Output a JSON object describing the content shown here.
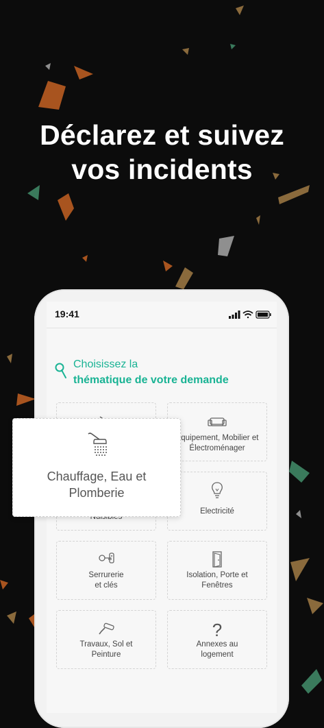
{
  "headline": {
    "line1": "Déclarez et suivez",
    "line2": "vos incidents"
  },
  "status_bar": {
    "time": "19:41"
  },
  "picker": {
    "title_line1": "Choisissez la",
    "title_line2": "thématique de votre demande",
    "accent_color": "#19b394"
  },
  "tiles": [
    {
      "label_line1": "Équipement, Mobilier et",
      "label_line2": "Électroménager",
      "icon": "sofa-icon"
    },
    {
      "label_line1": "Nuisibles",
      "label_line2": "",
      "icon": "bug-icon"
    },
    {
      "label_line1": "Electricité",
      "label_line2": "",
      "icon": "lightbulb-icon"
    },
    {
      "label_line1": "Serrurerie",
      "label_line2": "et clés",
      "icon": "keys-icon"
    },
    {
      "label_line1": "Isolation, Porte et",
      "label_line2": "Fenêtres",
      "icon": "door-icon"
    },
    {
      "label_line1": "Travaux, Sol et",
      "label_line2": "Peinture",
      "icon": "paint-roller-icon"
    },
    {
      "label_line1": "Annexes au",
      "label_line2": "logement",
      "icon": "question-mark-icon"
    }
  ],
  "selected_tile": {
    "label_line1": "Chauffage, Eau et",
    "label_line2": "Plomberie",
    "icon": "shower-icon"
  },
  "colors": {
    "background": "#0c0c0c",
    "confetti": [
      "#a8541f",
      "#3a7a5c",
      "#8f8f8f",
      "#8a6a3c"
    ]
  }
}
